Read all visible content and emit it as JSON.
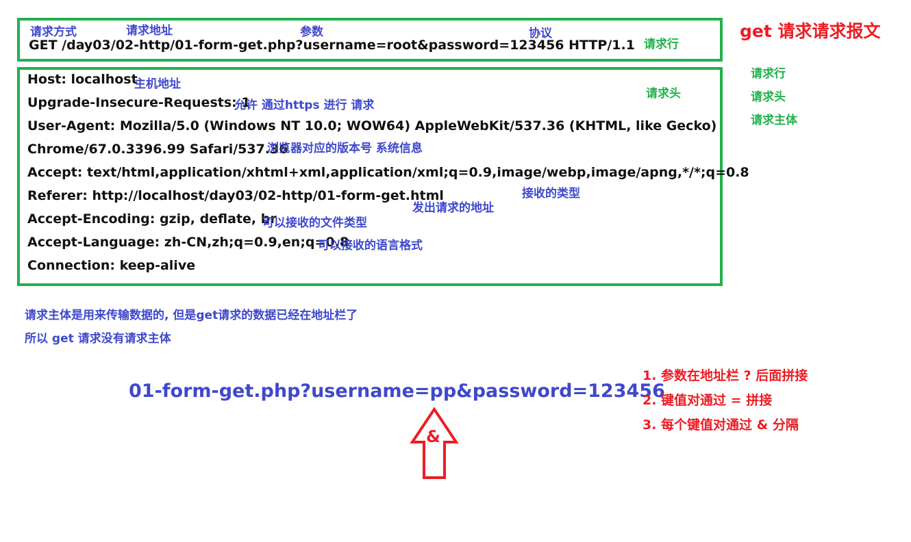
{
  "title": "get 请求请求报文",
  "request_line": {
    "label_method": "请求方式",
    "label_url": "请求地址",
    "label_params": "参数",
    "label_protocol": "协议",
    "text": "GET /day03/02-http/01-form-get.php?username=root&password=123456 HTTP/1.1",
    "tag": "请求行"
  },
  "headers": {
    "tag": "请求头",
    "lines": [
      {
        "text": "Host: localhost",
        "note": "主机地址"
      },
      {
        "text": "Upgrade-Insecure-Requests: 1",
        "note": "允许 通过https 进行 请求"
      },
      {
        "text": "User-Agent: Mozilla/5.0 (Windows NT 10.0; WOW64) AppleWebKit/537.36 (KHTML, like Gecko)",
        "note": ""
      },
      {
        "text": "Chrome/67.0.3396.99 Safari/537.36",
        "note": "浏览器对应的版本号  系统信息"
      },
      {
        "text": "Accept: text/html,application/xhtml+xml,application/xml;q=0.9,image/webp,image/apng,*/*;q=0.8",
        "note": "接收的类型"
      },
      {
        "text": "Referer: http://localhost/day03/02-http/01-form-get.html",
        "note": "发出请求的地址"
      },
      {
        "text": "Accept-Encoding: gzip, deflate, br",
        "note": "可以接收的文件类型"
      },
      {
        "text": "Accept-Language: zh-CN,zh;q=0.9,en;q=0.8",
        "note": "可以接收的语言格式"
      },
      {
        "text": "Connection: keep-alive",
        "note": ""
      }
    ]
  },
  "legend": [
    "请求行",
    "请求头",
    "请求主体"
  ],
  "body_note": {
    "line1": "请求主体是用来传输数据的, 但是get请求的数据已经在地址栏了",
    "line2": "所以 get 请求没有请求主体"
  },
  "example_url": "01-form-get.php?username=pp&password=123456",
  "arrow_label": "&",
  "rules": [
    "1. 参数在地址栏 ? 后面拼接",
    "2. 键值对通过 = 拼接",
    "3. 每个键值对通过 & 分隔"
  ]
}
